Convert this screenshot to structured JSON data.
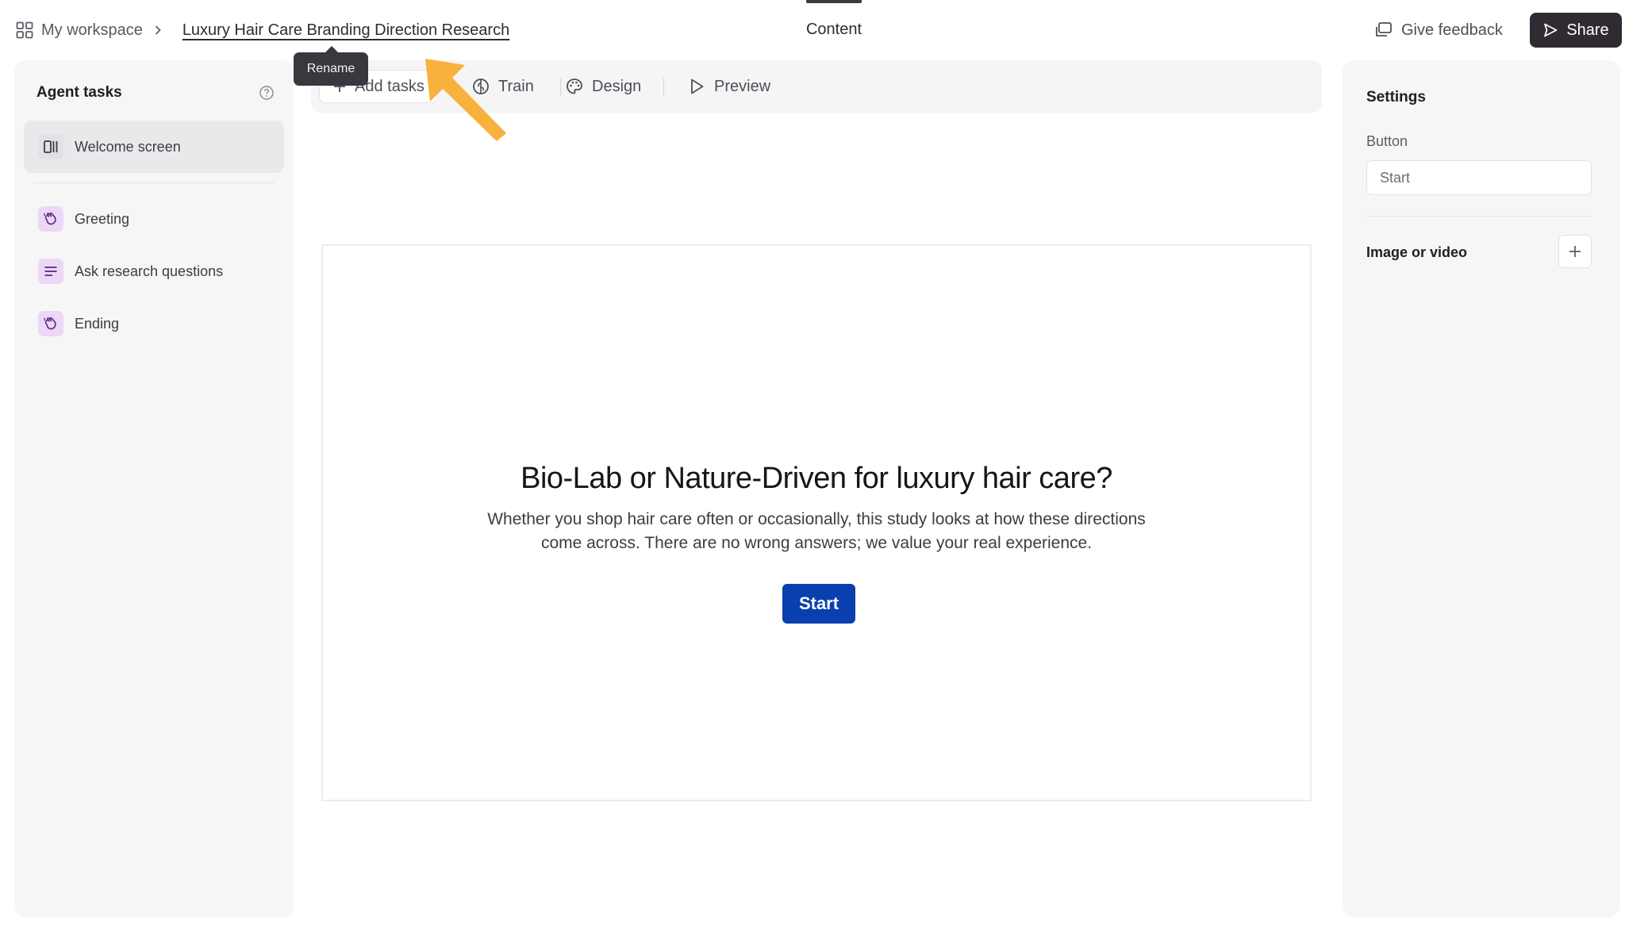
{
  "breadcrumb": {
    "workspace": "My workspace",
    "title": "Luxury Hair Care Branding Direction Research"
  },
  "tooltip": {
    "text": "Rename"
  },
  "top_center_tab": {
    "label": "Content"
  },
  "top_actions": {
    "feedback": "Give feedback",
    "share": "Share"
  },
  "left_panel": {
    "title": "Agent tasks",
    "items": [
      {
        "label": "Welcome screen",
        "icon": "welcome-screen-icon"
      },
      {
        "label": "Greeting",
        "icon": "wave-hand-icon"
      },
      {
        "label": "Ask research questions",
        "icon": "lines-icon"
      },
      {
        "label": "Ending",
        "icon": "wave-hand-icon"
      }
    ]
  },
  "toolbar": {
    "add_tasks": "Add tasks",
    "train": "Train",
    "design": "Design",
    "preview": "Preview"
  },
  "welcome": {
    "title": "Bio-Lab or Nature-Driven for luxury hair care?",
    "description": "Whether you shop hair care often or occasionally, this study looks at how these directions come across. There are no wrong answers; we value your real experience.",
    "button": "Start"
  },
  "settings": {
    "title": "Settings",
    "button_label": "Button",
    "button_value": "Start",
    "media_label": "Image or video"
  },
  "colors": {
    "accent_blue": "#0a3fb0",
    "share_bg": "#302b33",
    "annotation_arrow": "#f8b13c",
    "task_icon_purple": "#ecd7f6"
  }
}
